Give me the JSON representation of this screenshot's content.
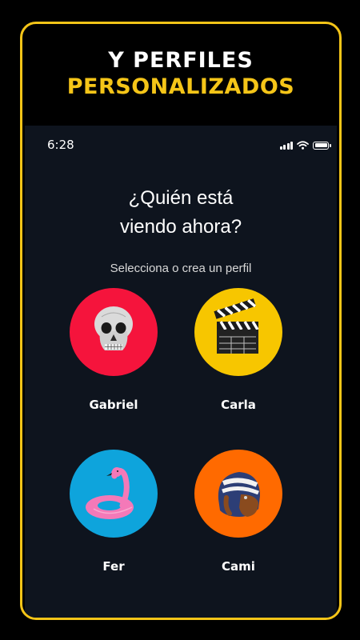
{
  "headline": {
    "line1": "Y PERFILES",
    "line2": "PERSONALIZADOS"
  },
  "status_bar": {
    "time": "6:28"
  },
  "title": {
    "line1": "¿Quién está",
    "line2": "viendo ahora?"
  },
  "subtitle": "Selecciona o crea un perfil",
  "profiles": [
    {
      "name": "Gabriel",
      "color": "#F5143C",
      "icon": "skull-icon"
    },
    {
      "name": "Carla",
      "color": "#F7C600",
      "icon": "clapperboard-icon"
    },
    {
      "name": "Fer",
      "color": "#0EA4DC",
      "icon": "flamingo-float-icon"
    },
    {
      "name": "Cami",
      "color": "#FF6A00",
      "icon": "helmet-icon"
    }
  ],
  "colors": {
    "accent": "#F5C518",
    "screen_bg": "#0E141E",
    "page_bg": "#000000"
  }
}
